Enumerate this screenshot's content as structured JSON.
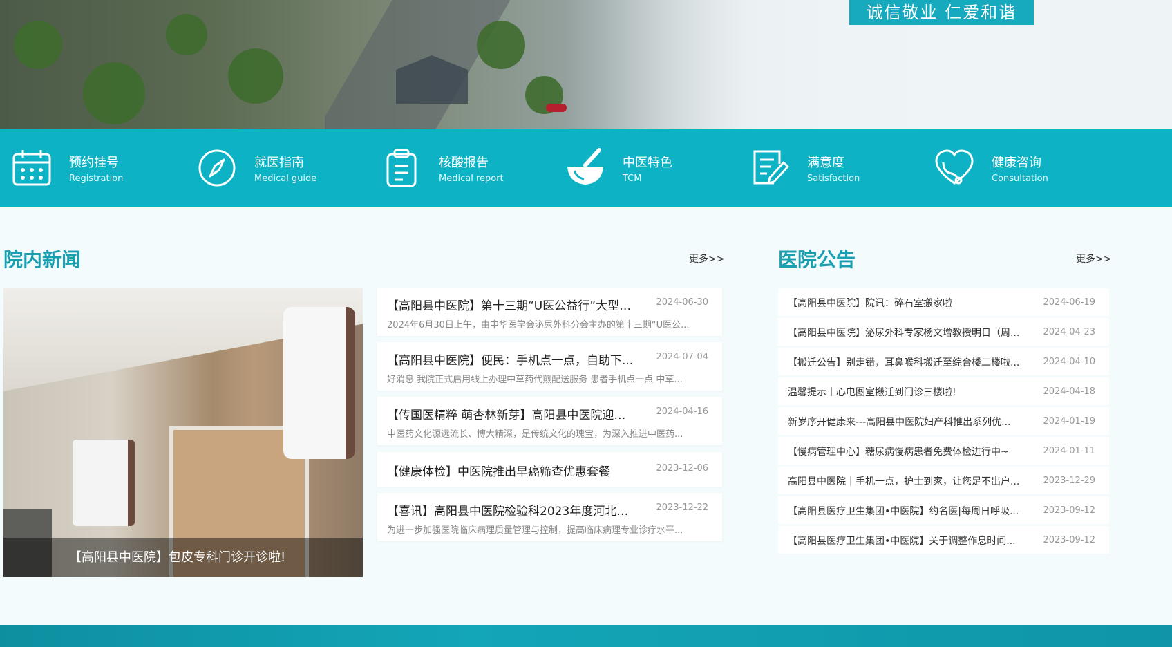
{
  "banner": {
    "slogan": "诚信敬业 仁爱和谐"
  },
  "quick_menu": [
    {
      "zh": "预约挂号",
      "en": "Registration",
      "icon": "calendar-icon"
    },
    {
      "zh": "就医指南",
      "en": "Medical guide",
      "icon": "compass-icon"
    },
    {
      "zh": "核酸报告",
      "en": "Medical report",
      "icon": "clipboard-icon"
    },
    {
      "zh": "中医特色",
      "en": "TCM",
      "icon": "mortar-icon"
    },
    {
      "zh": "满意度",
      "en": "Satisfaction",
      "icon": "survey-pen-icon"
    },
    {
      "zh": "健康咨询",
      "en": "Consultation",
      "icon": "heart-stethoscope-icon"
    }
  ],
  "news": {
    "title": "院内新闻",
    "more": "更多>>",
    "featured_caption": "【高阳县中医院】包皮专科门诊开诊啦!",
    "items": [
      {
        "title": "【高阳县中医院】第十三期“U医公益行”大型泌...",
        "date": "2024-06-30",
        "summary": "2024年6月30日上午，由中华医学会泌尿外科分会主办的第十三期“U医公..."
      },
      {
        "title": "【高阳县中医院】便民：手机点一点，自助下...",
        "date": "2024-07-04",
        "summary": "好消息 我院正式启用线上办理中草药代煎配送服务 患者手机点一点 中草..."
      },
      {
        "title": "【传国医精粹 萌杏林新芽】高阳县中医院迎来...",
        "date": "2024-04-16",
        "summary": "中医药文化源远流长、博大精深，是传统文化的瑰宝，为深入推进中医药..."
      },
      {
        "title": "【健康体检】中医院推出早癌筛查优惠套餐",
        "date": "2023-12-06",
        "summary": ""
      },
      {
        "title": "【喜讯】高阳县中医院检验科2023年度河北省...",
        "date": "2023-12-22",
        "summary": "为进一步加强医院临床病理质量管理与控制，提高临床病理专业诊疗水平..."
      }
    ]
  },
  "notices": {
    "title": "医院公告",
    "more": "更多>>",
    "items": [
      {
        "title": "【高阳县中医院】院讯：碎石室搬家啦",
        "date": "2024-06-19"
      },
      {
        "title": "【高阳县中医院】泌尿外科专家杨文增教授明日（周...",
        "date": "2024-04-23"
      },
      {
        "title": "【搬迁公告】别走错，耳鼻喉科搬迁至综合楼二楼啦...",
        "date": "2024-04-10"
      },
      {
        "title": "温馨提示丨心电图室搬迁到门诊三楼啦!",
        "date": "2024-04-18"
      },
      {
        "title": "新岁序开健康来---高阳县中医院妇产科推出系列优...",
        "date": "2024-01-19"
      },
      {
        "title": "【慢病管理中心】糖尿病慢病患者免费体检进行中~",
        "date": "2024-01-11"
      },
      {
        "title": "高阳县中医院｜手机一点，护士到家，让您足不出户...",
        "date": "2023-12-29"
      },
      {
        "title": "【高阳县医疗卫生集团•中医院】约名医|每周日呼吸...",
        "date": "2023-09-12"
      },
      {
        "title": "【高阳县医疗卫生集团•中医院】关于调整作息时间...",
        "date": "2023-09-12"
      }
    ]
  }
}
